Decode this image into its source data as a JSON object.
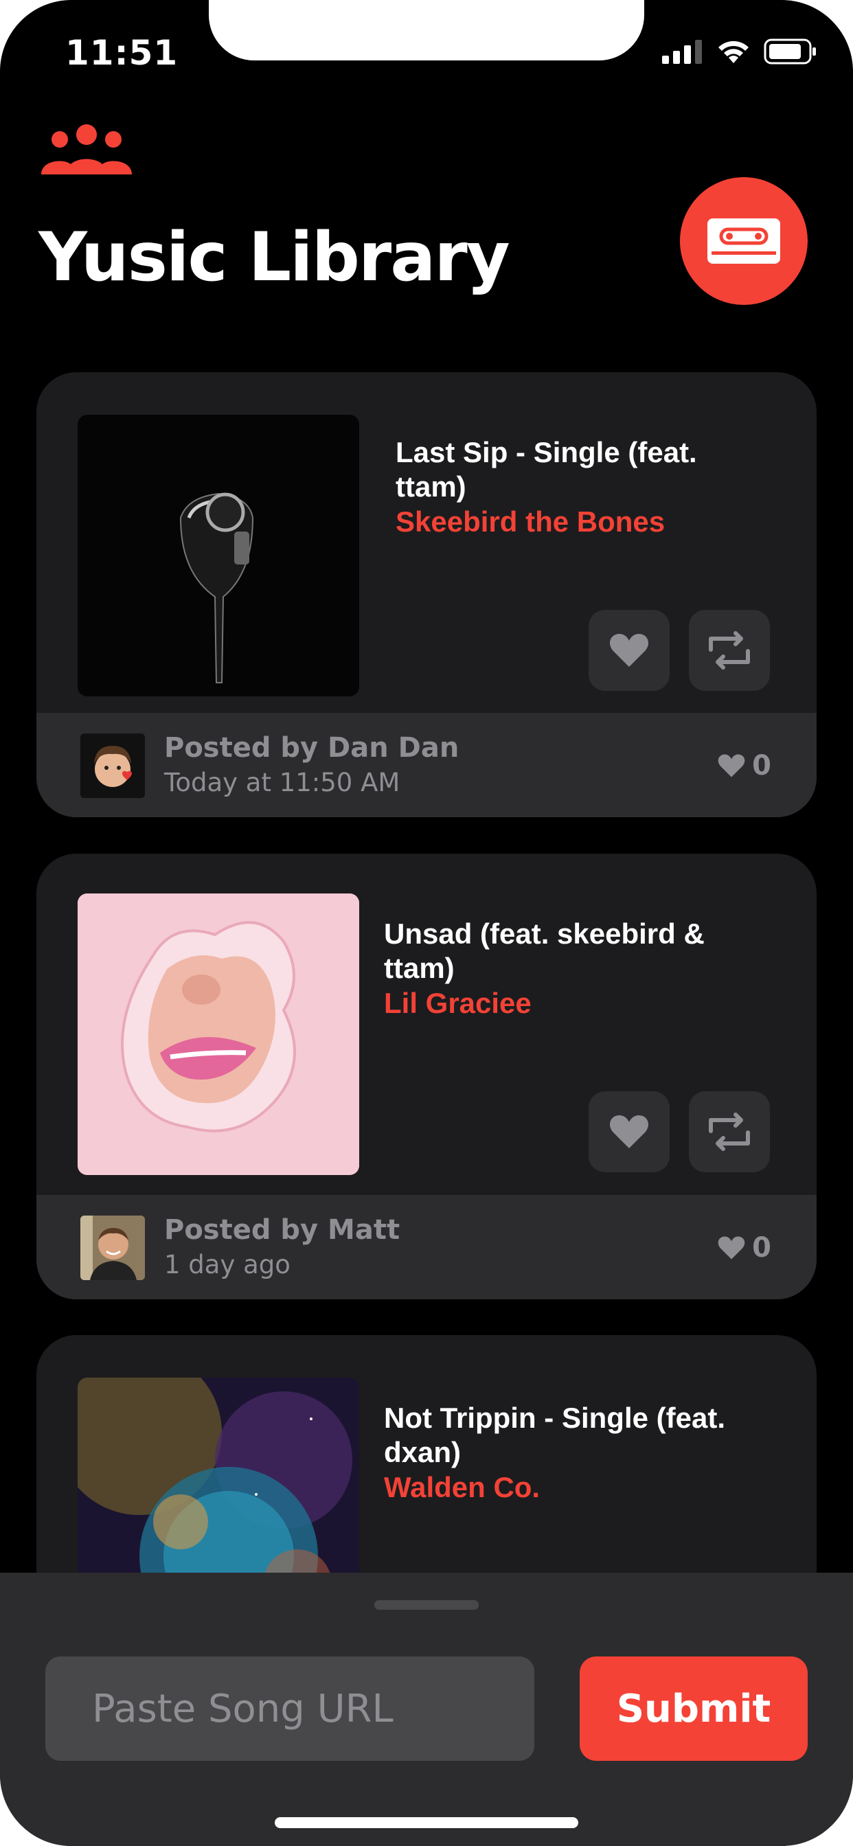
{
  "status_bar": {
    "time": "11:51"
  },
  "header": {
    "title": "Yusic Library",
    "group_icon": "people-group-icon",
    "action_icon": "cassette-icon"
  },
  "colors": {
    "accent": "#f44236",
    "background": "#000000",
    "card": "#1c1c1e",
    "footer": "#2c2c2e",
    "muted": "#8e8e93"
  },
  "posts": [
    {
      "title": "Last Sip - Single (feat. ttam)",
      "artist": "Skeebird the Bones",
      "posted_by": "Posted by Dan Dan",
      "posted_time": "Today at 11:50 AM",
      "likes": "0"
    },
    {
      "title": "Unsad (feat. skeebird & ttam)",
      "artist": "Lil Graciee",
      "posted_by": "Posted by Matt",
      "posted_time": "1 day ago",
      "likes": "0"
    },
    {
      "title": "Not Trippin - Single (feat. dxan)",
      "artist": "Walden Co."
    }
  ],
  "composer": {
    "placeholder": "Paste Song URL",
    "submit_label": "Submit"
  }
}
